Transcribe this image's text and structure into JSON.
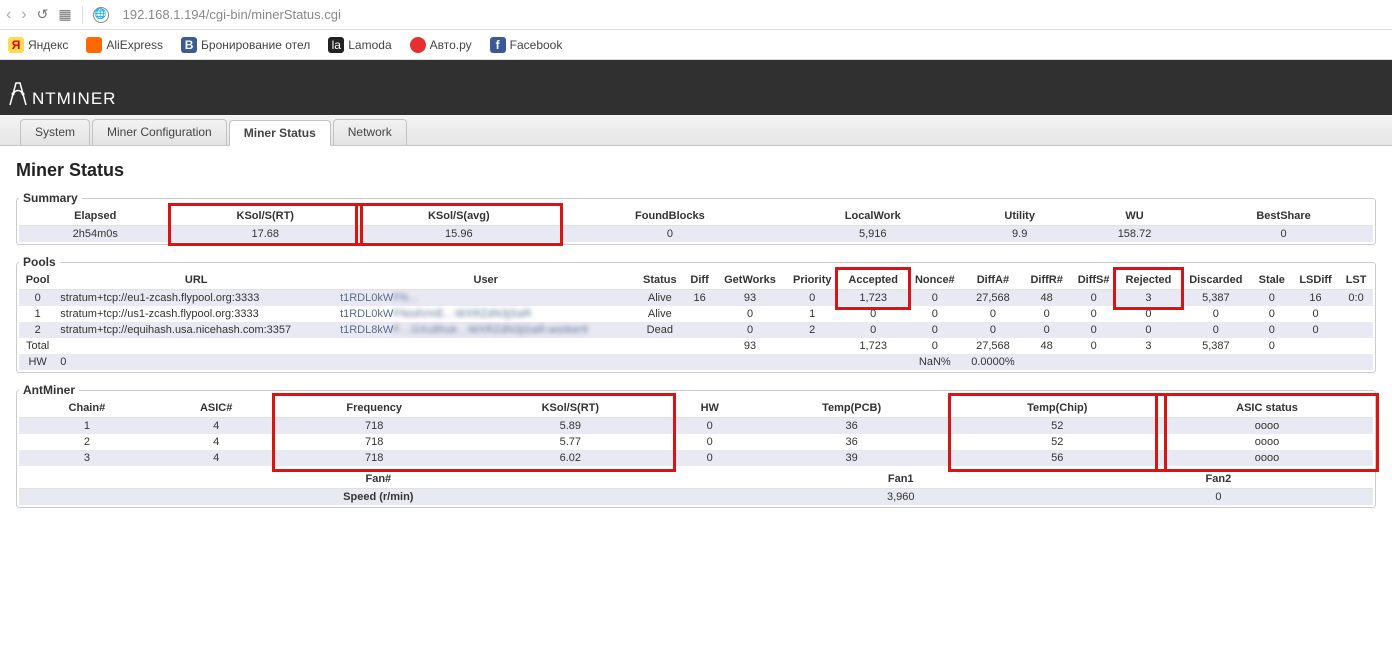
{
  "browser": {
    "url": "192.168.1.194/cgi-bin/minerStatus.cgi",
    "bookmarks": [
      "Яндекс",
      "AliExpress",
      "Бронирование отел",
      "Lamoda",
      "Авто.ру",
      "Facebook"
    ]
  },
  "brand": "NTMINER",
  "tabs": [
    "System",
    "Miner Configuration",
    "Miner Status",
    "Network"
  ],
  "activeTab": 2,
  "pageTitle": "Miner Status",
  "summary": {
    "legend": "Summary",
    "headers": [
      "Elapsed",
      "KSol/S(RT)",
      "KSol/S(avg)",
      "FoundBlocks",
      "LocalWork",
      "Utility",
      "WU",
      "BestShare"
    ],
    "values": [
      "2h54m0s",
      "17.68",
      "15.96",
      "0",
      "5,916",
      "9.9",
      "158.72",
      "0"
    ]
  },
  "pools": {
    "legend": "Pools",
    "headers": [
      "Pool",
      "URL",
      "User",
      "Status",
      "Diff",
      "GetWorks",
      "Priority",
      "Accepted",
      "Nonce#",
      "DiffA#",
      "DiffR#",
      "DiffS#",
      "Rejected",
      "Discarded",
      "Stale",
      "LSDiff",
      "LST"
    ],
    "rows": [
      [
        "0",
        "stratum+tcp://eu1-zcash.flypool.org:3333",
        "t1RDL0kWFN…",
        "Alive",
        "16",
        "93",
        "0",
        "1,723",
        "0",
        "27,568",
        "48",
        "0",
        "3",
        "5,387",
        "0",
        "16",
        "0:0"
      ],
      [
        "1",
        "stratum+tcp://us1-zcash.flypool.org:3333",
        "t1RDL0kWFNodVmE…WXRZdN3jSaR",
        "Alive",
        "",
        "0",
        "1",
        "0",
        "0",
        "0",
        "0",
        "0",
        "0",
        "0",
        "0",
        "0",
        ""
      ],
      [
        "2",
        "stratum+tcp://equihash.usa.nicehash.com:3357",
        "t1RDL8kWF…GXu8huk…WXRZdN3jGaR.worker9",
        "Dead",
        "",
        "0",
        "2",
        "0",
        "0",
        "0",
        "0",
        "0",
        "0",
        "0",
        "0",
        "0",
        ""
      ],
      [
        "Total",
        "",
        "",
        "",
        "",
        "93",
        "",
        "1,723",
        "0",
        "27,568",
        "48",
        "0",
        "3",
        "5,387",
        "0",
        "",
        ""
      ],
      [
        "HW",
        "0",
        "",
        "",
        "",
        "",
        "",
        "",
        "NaN%",
        "0.0000%",
        "",
        "",
        "",
        "",
        "",
        "",
        ""
      ]
    ]
  },
  "antminer": {
    "legend": "AntMiner",
    "chainHeaders": [
      "Chain#",
      "ASIC#",
      "Frequency",
      "KSol/S(RT)",
      "HW",
      "Temp(PCB)",
      "Temp(Chip)",
      "ASIC status"
    ],
    "chainRows": [
      [
        "1",
        "4",
        "718",
        "5.89",
        "0",
        "36",
        "52",
        "oooo"
      ],
      [
        "2",
        "4",
        "718",
        "5.77",
        "0",
        "36",
        "52",
        "oooo"
      ],
      [
        "3",
        "4",
        "718",
        "6.02",
        "0",
        "39",
        "56",
        "oooo"
      ]
    ],
    "fanHeaders": [
      "Fan#",
      "Fan1",
      "Fan2"
    ],
    "fanRow": [
      "Speed (r/min)",
      "3,960",
      "0"
    ]
  }
}
